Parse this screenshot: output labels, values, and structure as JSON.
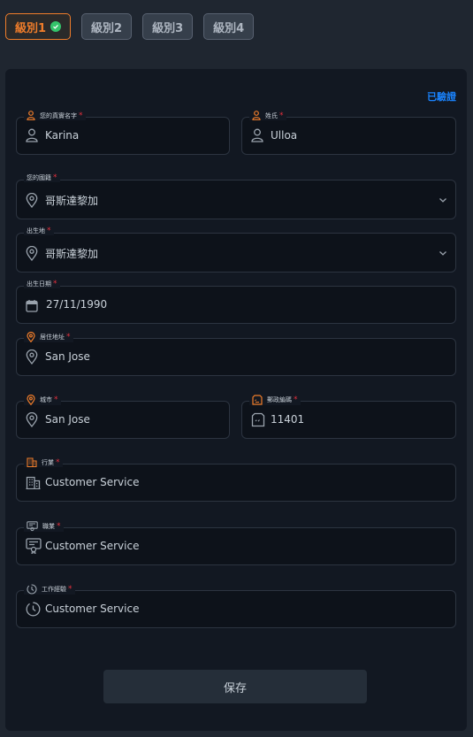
{
  "tabs": [
    {
      "label": "級別1",
      "state": "active",
      "completed": true
    },
    {
      "label": "級別2",
      "state": "inactive"
    },
    {
      "label": "級別3",
      "state": "inactive"
    },
    {
      "label": "級別4",
      "state": "inactive"
    }
  ],
  "verified_label": "已驗證",
  "fields": {
    "first_name": {
      "label": "您的真實名字",
      "value": "Karina"
    },
    "last_name": {
      "label": "姓氏",
      "value": "Ulloa"
    },
    "nationality": {
      "label": "您的國籍",
      "value": "哥斯達黎加"
    },
    "birthplace": {
      "label": "出生地",
      "value": "哥斯達黎加"
    },
    "birth_date": {
      "label": "出生日期",
      "value": "27/11/1990"
    },
    "address": {
      "label": "居住地址",
      "value": "San Jose"
    },
    "city": {
      "label": "城市",
      "value": "San Jose"
    },
    "postal_code": {
      "label": "郵政編碼",
      "value": "11401"
    },
    "industry": {
      "label": "行業",
      "value": "Customer Service"
    },
    "occupation": {
      "label": "職業",
      "value": "Customer Service"
    },
    "work_experience": {
      "label": "工作經驗",
      "value": "Customer Service"
    }
  },
  "required_marker": "*",
  "save_label": "保存",
  "colors": {
    "accent": "#f07d2a",
    "link": "#1a84ff",
    "required": "#e5303d",
    "success": "#34c46b"
  },
  "icons": {
    "first_name": "user-icon",
    "last_name": "user-icon",
    "nationality": "location-pin-icon",
    "birthplace": "location-pin-icon",
    "birth_date": "calendar-icon",
    "address": "location-pin-icon",
    "city": "location-pin-icon",
    "postal_code": "postcode-icon",
    "industry": "building-icon",
    "occupation": "certificate-icon",
    "work_experience": "clock-icon"
  }
}
